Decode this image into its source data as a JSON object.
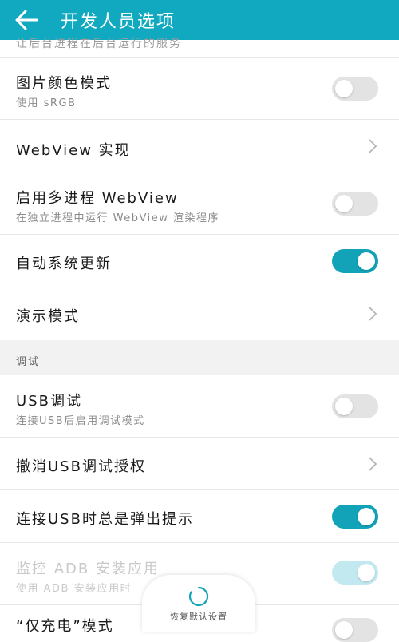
{
  "app_bar": {
    "title": "开发人员选项",
    "back_icon": "arrow-left-icon"
  },
  "clipped_text": "让后台进程在后台运行的服务",
  "rows": [
    {
      "label": "图片颜色模式",
      "sub": "使用 sRGB",
      "control": "toggle",
      "on": false
    },
    {
      "label": "WebView 实现",
      "control": "chevron"
    },
    {
      "label": "启用多进程 WebView",
      "sub": "在独立进程中运行 WebView 渲染程序",
      "control": "toggle",
      "on": false
    },
    {
      "label": "自动系统更新",
      "control": "toggle",
      "on": true
    },
    {
      "label": "演示模式",
      "control": "chevron"
    }
  ],
  "section_debug": "调试",
  "debug_rows": [
    {
      "label": "USB调试",
      "sub": "连接USB后启用调试模式",
      "control": "toggle",
      "on": false
    },
    {
      "label": "撤消USB调试授权",
      "control": "chevron"
    },
    {
      "label": "连接USB时总是弹出提示",
      "control": "toggle",
      "on": true
    },
    {
      "label": "监控 ADB 安装应用",
      "sub": "使用 ADB 安装应用时",
      "control": "toggle",
      "on": true,
      "disabled": true
    }
  ],
  "partial_row": "“仅充电”模式",
  "toast": {
    "text": "恢复默认设置"
  },
  "colors": {
    "accent": "#11a9bf",
    "toggle_on": "#12a3b8"
  }
}
